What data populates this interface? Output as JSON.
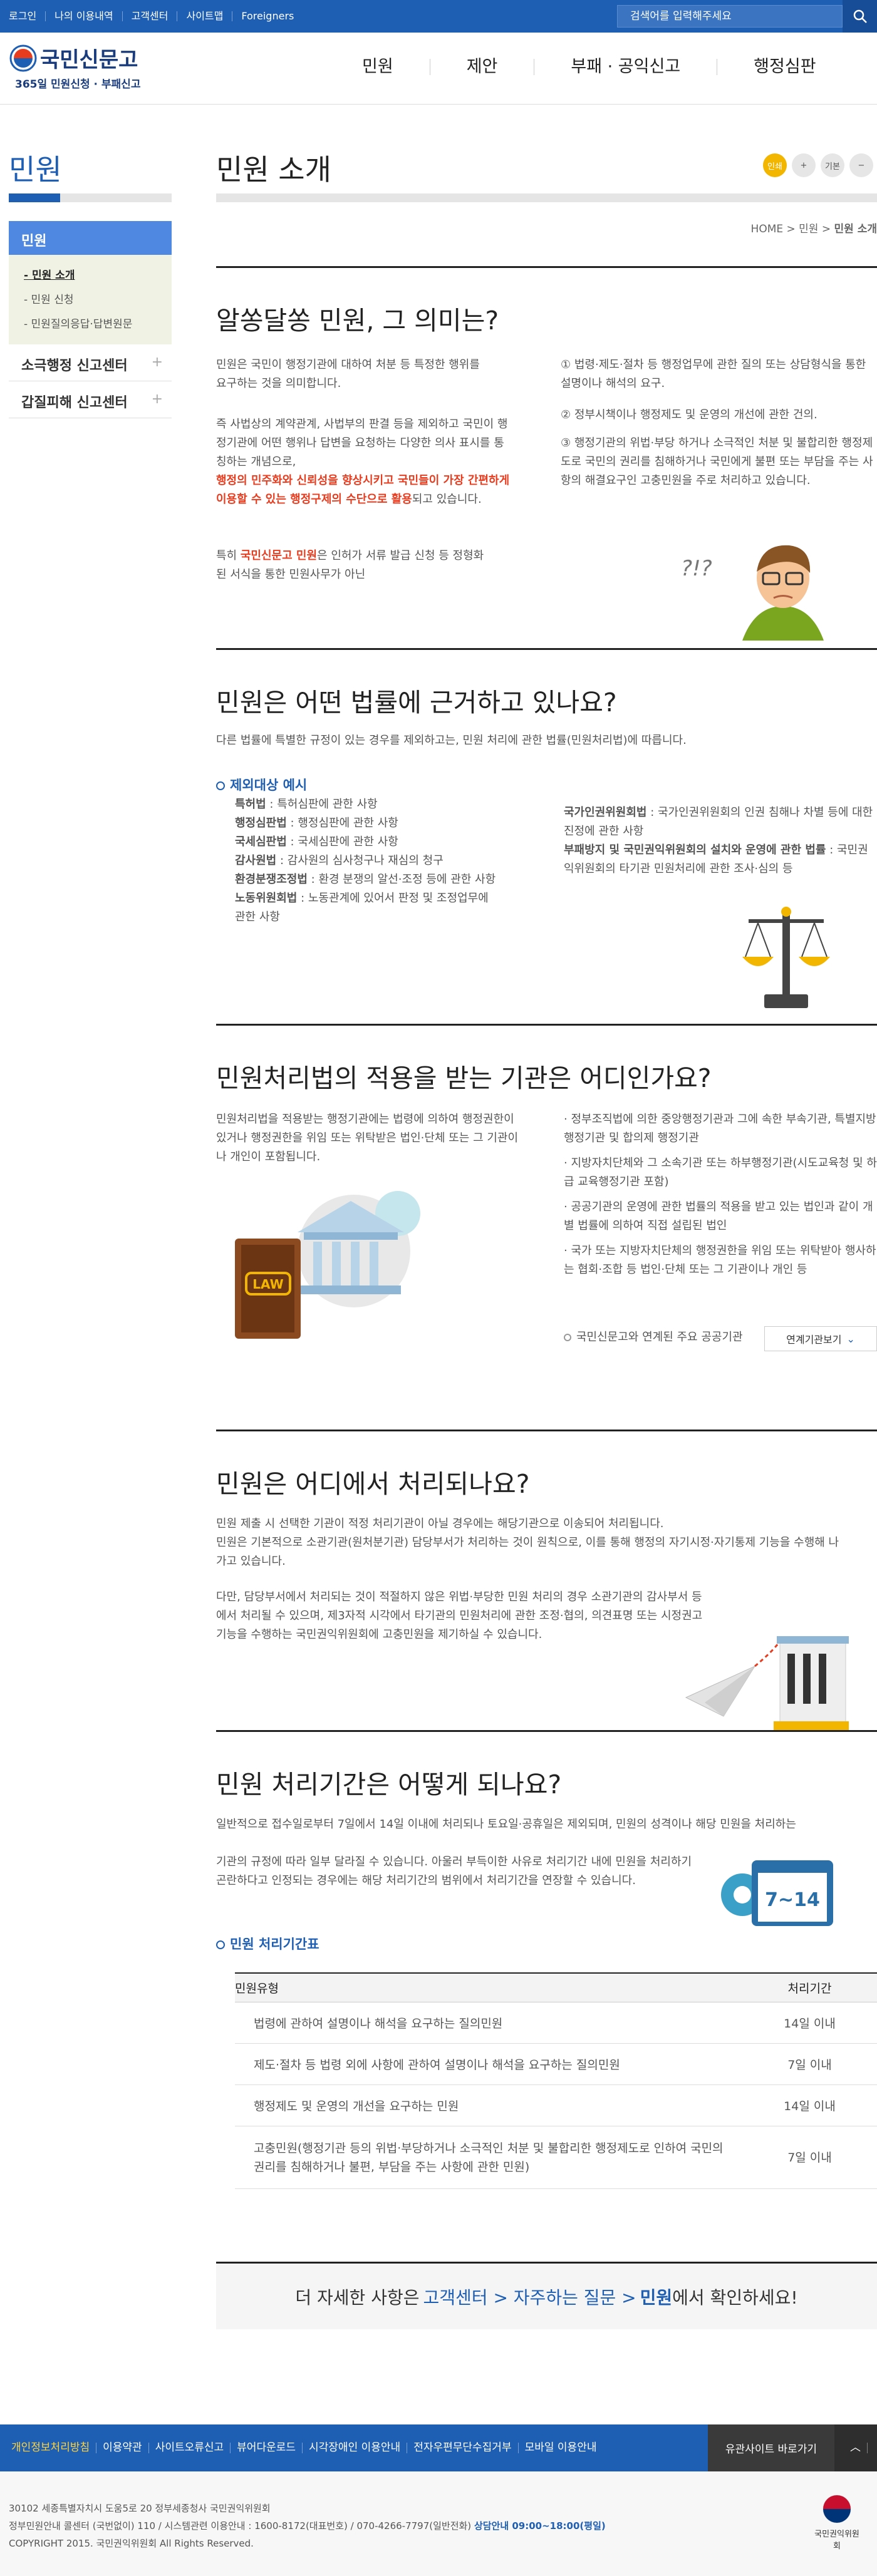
{
  "topbar": {
    "links": [
      "로그인",
      "나의 이용내역",
      "고객센터",
      "사이트맵",
      "Foreigners"
    ],
    "search_placeholder": "검색어를 입력해주세요"
  },
  "logo": {
    "title": "국민신문고",
    "subtitle": "365일 민원신청 · 부패신고"
  },
  "gnb": [
    "민원",
    "제안",
    "부패 · 공익신고",
    "행정심판"
  ],
  "lnb": {
    "title": "민원",
    "active": "민원",
    "sub": [
      "민원 소개",
      "민원 신청",
      "민원질의응답·답변원문"
    ],
    "menus": [
      "소극행정 신고센터",
      "갑질피해 신고센터"
    ]
  },
  "page": {
    "title": "민원 소개",
    "tools": [
      "인쇄",
      "+",
      "기본",
      "−"
    ],
    "breadcrumb": [
      "HOME",
      ">",
      "민원",
      ">",
      "민원 소개"
    ]
  },
  "s1": {
    "title": "알쏭달쏭 민원, 그 의미는?",
    "p1": "민원은 국민이 행정기관에 대하여 처분 등 특정한 행위를 요구하는 것을 의미합니다.",
    "p2a": "즉 사법상의 계약관계, 사법부의 판결 등을 제외하고 국민이 행정기관에 어떤 행위나 답변을 요청하는 다양한 의사 표시를 통칭하는 개념으로,",
    "p2b": "행정의 민주화와 신뢰성을 향상시키고 국민들이 가장 간편하게 이용할 수 있는 행정구제의 수단으로 활용",
    "p2c": "되고 있습니다.",
    "p3a": "특히 ",
    "p3b": "국민신문고 민원",
    "p3c": "은 인허가 서류 발급 신청 등 정형화된 서식을 통한 민원사무가 아닌",
    "items": [
      "① 법령·제도·절차 등 행정업무에 관한 질의 또는 상담형식을 통한 설명이나 해석의 요구.",
      "② 정부시책이나 행정제도 및 운영의 개선에 관한 건의.",
      "③ 행정기관의 위법·부당 하거나 소극적인 처분 및 불합리한 행정제도로 국민의 권리를 침해하거나 국민에게 불편 또는 부담을 주는 사항의 해결요구인 고충민원을 주로 처리하고 있습니다."
    ],
    "deco": "?!?"
  },
  "s2": {
    "title": "민원은 어떤 법률에 근거하고 있나요?",
    "p1": "다른 법률에 특별한 규정이 있는 경우를 제외하고는, 민원 처리에 관한 법률(민원처리법)에 따릅니다.",
    "sub": "제외대상 예시",
    "left": [
      [
        "특허법",
        "특허심판에 관한 사항"
      ],
      [
        "행정심판법",
        "행정심판에 관한 사항"
      ],
      [
        "국세심판법",
        "국세심판에 관한 사항"
      ],
      [
        "감사원법",
        "감사원의 심사청구나 재심의 청구"
      ],
      [
        "환경분쟁조정법",
        "환경 분쟁의 알선·조정 등에 관한 사항"
      ],
      [
        "노동위원회법",
        "노동관계에 있어서 판정 및 조정업무에 관한 사항"
      ]
    ],
    "right": [
      [
        "국가인권위원회법",
        "국가인권위원회의 인권 침해나 차별 등에 대한 진정에 관한 사항"
      ],
      [
        "부패방지 및 국민권익위원회의 설치와 운영에 관한 법률",
        "국민권익위원회의 타기관 민원처리에 관한 조사·심의 등"
      ]
    ]
  },
  "s3": {
    "title": "민원처리법의 적용을 받는 기관은 어디인가요?",
    "p1": "민원처리법을 적용받는 행정기관에는 법령에 의하여 행정권한이 있거나 행정권한을 위임 또는 위탁받은 법인·단체 또는 그 기관이나 개인이 포함됩니다.",
    "items": [
      "정부조직법에 의한 중앙행정기관과 그에 속한 부속기관, 특별지방행정기관 및 합의제 행정기관",
      "지방자치단체와 그 소속기관 또는 하부행정기관(시도교육청 및 하급 교육행정기관 포함)",
      "공공기관의 운영에 관한 법률의 적용을 받고 있는 법인과 같이 개별 법률에 의하여 직접 설립된 법인",
      "국가 또는 지방자치단체의 행정권한을 위임 또는 위탁받아 행사하는 협회·조합 등 법인·단체 또는 그 기관이나 개인 등"
    ],
    "link": "국민신문고와 연계된 주요 공공기관",
    "button": "연계기관보기",
    "law": "LAW"
  },
  "s4": {
    "title": "민원은 어디에서 처리되나요?",
    "p1": "민원 제출 시 선택한 기관이 적정 처리기관이 아닐 경우에는 해당기관으로 이송되어 처리됩니다.",
    "p2": "민원은 기본적으로 소관기관(원처분기관) 담당부서가 처리하는 것이 원칙으로, 이를 통해 행정의 자기시정·자기통제 기능을 수행해 나가고 있습니다.",
    "p3": "다만, 담당부서에서 처리되는 것이 적절하지 않은 위법·부당한 민원 처리의 경우 소관기관의 감사부서 등에서 처리될 수 있으며, 제3자적 시각에서 타기관의 민원처리에 관한 조정·협의, 의견표명 또는 시정권고 기능을 수행하는 국민권익위원회에 고충민원을 제기하실 수 있습니다."
  },
  "s5": {
    "title": "민원 처리기간은 어떻게 되나요?",
    "p1": "일반적으로 접수일로부터 7일에서 14일 이내에 처리되나 토요일·공휴일은 제외되며, 민원의 성격이나 해당 민원을 처리하는",
    "p2": "기관의 규정에 따라 일부 달라질 수 있습니다. 아울러 부득이한 사유로 처리기간 내에 민원을 처리하기 곤란하다고 인정되는 경우에는 해당 처리기간의 범위에서 처리기간을 연장할 수 있습니다.",
    "badge": "7~14",
    "sub": "민원 처리기간표",
    "head": [
      "민원유형",
      "처리기간"
    ],
    "rows": [
      [
        "법령에 관하여 설명이나 해석을 요구하는 질의민원",
        "14일 이내"
      ],
      [
        "제도·절차 등 법령 외에 사항에 관하여 설명이나 해석을 요구하는 질의민원",
        "7일 이내"
      ],
      [
        "행정제도 및 운영의 개선을 요구하는 민원",
        "14일 이내"
      ],
      [
        "고충민원(행정기관 등의 위법·부당하거나 소극적인 처분 및 불합리한 행정제도로 인하여 국민의 권리를 침해하거나 불편, 부담을 주는 사항에 관한 민원)",
        "7일 이내"
      ]
    ]
  },
  "banner": {
    "a": "더 자세한 사항은 ",
    "b": "고객센터 > 자주하는 질문 > ",
    "c": "민원",
    "d": " 에서 확인하세요!"
  },
  "footer": {
    "links": [
      "개인정보처리방침",
      "이용약관",
      "사이트오류신고",
      "뷰어다운로드",
      "시각장애인 이용안내",
      "전자우편무단수집거부",
      "모바일 이용안내"
    ],
    "related": "유관사이트 바로가기",
    "addr": "30102 세종특별자치시 도움5로 20 정부세종청사 국민권익위원회",
    "contact": "정부민원안내 콜센터 (국번없이) 110 / 시스템관련 이용안내 : 1600-8172(대표번호) / 070-4266-7797(일반전화)",
    "hours": "상담안내 09:00~18:00(평일)",
    "copy": "COPYRIGHT 2015. 국민권익위원회 All Rights Reserved.",
    "org": "국민권익위원회"
  },
  "colors": {
    "primary": "#1f5fb3",
    "accent_red": "#e83c1f",
    "footer_nav": "#1f5fb3"
  }
}
